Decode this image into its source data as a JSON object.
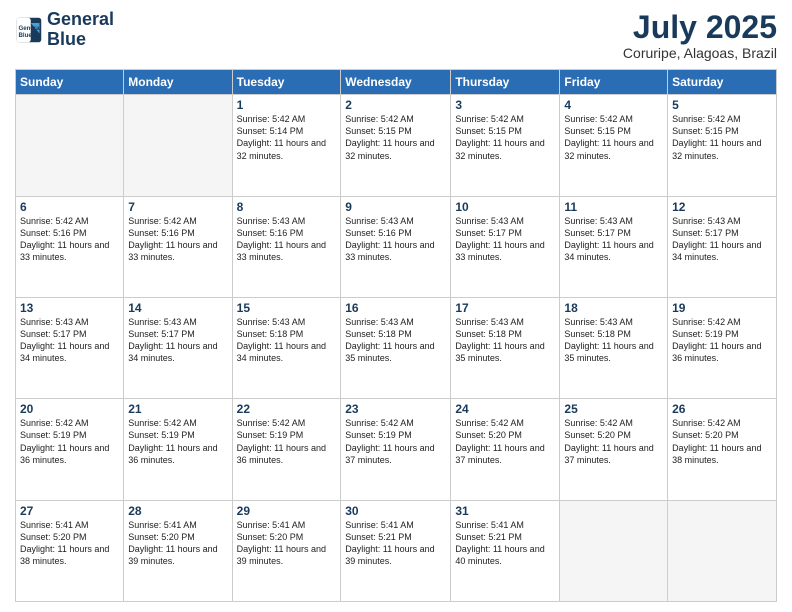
{
  "header": {
    "logo_line1": "General",
    "logo_line2": "Blue",
    "main_title": "July 2025",
    "subtitle": "Coruripe, Alagoas, Brazil"
  },
  "weekdays": [
    "Sunday",
    "Monday",
    "Tuesday",
    "Wednesday",
    "Thursday",
    "Friday",
    "Saturday"
  ],
  "weeks": [
    [
      {
        "day": "",
        "info": ""
      },
      {
        "day": "",
        "info": ""
      },
      {
        "day": "1",
        "info": "Sunrise: 5:42 AM\nSunset: 5:14 PM\nDaylight: 11 hours and 32 minutes."
      },
      {
        "day": "2",
        "info": "Sunrise: 5:42 AM\nSunset: 5:15 PM\nDaylight: 11 hours and 32 minutes."
      },
      {
        "day": "3",
        "info": "Sunrise: 5:42 AM\nSunset: 5:15 PM\nDaylight: 11 hours and 32 minutes."
      },
      {
        "day": "4",
        "info": "Sunrise: 5:42 AM\nSunset: 5:15 PM\nDaylight: 11 hours and 32 minutes."
      },
      {
        "day": "5",
        "info": "Sunrise: 5:42 AM\nSunset: 5:15 PM\nDaylight: 11 hours and 32 minutes."
      }
    ],
    [
      {
        "day": "6",
        "info": "Sunrise: 5:42 AM\nSunset: 5:16 PM\nDaylight: 11 hours and 33 minutes."
      },
      {
        "day": "7",
        "info": "Sunrise: 5:42 AM\nSunset: 5:16 PM\nDaylight: 11 hours and 33 minutes."
      },
      {
        "day": "8",
        "info": "Sunrise: 5:43 AM\nSunset: 5:16 PM\nDaylight: 11 hours and 33 minutes."
      },
      {
        "day": "9",
        "info": "Sunrise: 5:43 AM\nSunset: 5:16 PM\nDaylight: 11 hours and 33 minutes."
      },
      {
        "day": "10",
        "info": "Sunrise: 5:43 AM\nSunset: 5:17 PM\nDaylight: 11 hours and 33 minutes."
      },
      {
        "day": "11",
        "info": "Sunrise: 5:43 AM\nSunset: 5:17 PM\nDaylight: 11 hours and 34 minutes."
      },
      {
        "day": "12",
        "info": "Sunrise: 5:43 AM\nSunset: 5:17 PM\nDaylight: 11 hours and 34 minutes."
      }
    ],
    [
      {
        "day": "13",
        "info": "Sunrise: 5:43 AM\nSunset: 5:17 PM\nDaylight: 11 hours and 34 minutes."
      },
      {
        "day": "14",
        "info": "Sunrise: 5:43 AM\nSunset: 5:17 PM\nDaylight: 11 hours and 34 minutes."
      },
      {
        "day": "15",
        "info": "Sunrise: 5:43 AM\nSunset: 5:18 PM\nDaylight: 11 hours and 34 minutes."
      },
      {
        "day": "16",
        "info": "Sunrise: 5:43 AM\nSunset: 5:18 PM\nDaylight: 11 hours and 35 minutes."
      },
      {
        "day": "17",
        "info": "Sunrise: 5:43 AM\nSunset: 5:18 PM\nDaylight: 11 hours and 35 minutes."
      },
      {
        "day": "18",
        "info": "Sunrise: 5:43 AM\nSunset: 5:18 PM\nDaylight: 11 hours and 35 minutes."
      },
      {
        "day": "19",
        "info": "Sunrise: 5:42 AM\nSunset: 5:19 PM\nDaylight: 11 hours and 36 minutes."
      }
    ],
    [
      {
        "day": "20",
        "info": "Sunrise: 5:42 AM\nSunset: 5:19 PM\nDaylight: 11 hours and 36 minutes."
      },
      {
        "day": "21",
        "info": "Sunrise: 5:42 AM\nSunset: 5:19 PM\nDaylight: 11 hours and 36 minutes."
      },
      {
        "day": "22",
        "info": "Sunrise: 5:42 AM\nSunset: 5:19 PM\nDaylight: 11 hours and 36 minutes."
      },
      {
        "day": "23",
        "info": "Sunrise: 5:42 AM\nSunset: 5:19 PM\nDaylight: 11 hours and 37 minutes."
      },
      {
        "day": "24",
        "info": "Sunrise: 5:42 AM\nSunset: 5:20 PM\nDaylight: 11 hours and 37 minutes."
      },
      {
        "day": "25",
        "info": "Sunrise: 5:42 AM\nSunset: 5:20 PM\nDaylight: 11 hours and 37 minutes."
      },
      {
        "day": "26",
        "info": "Sunrise: 5:42 AM\nSunset: 5:20 PM\nDaylight: 11 hours and 38 minutes."
      }
    ],
    [
      {
        "day": "27",
        "info": "Sunrise: 5:41 AM\nSunset: 5:20 PM\nDaylight: 11 hours and 38 minutes."
      },
      {
        "day": "28",
        "info": "Sunrise: 5:41 AM\nSunset: 5:20 PM\nDaylight: 11 hours and 39 minutes."
      },
      {
        "day": "29",
        "info": "Sunrise: 5:41 AM\nSunset: 5:20 PM\nDaylight: 11 hours and 39 minutes."
      },
      {
        "day": "30",
        "info": "Sunrise: 5:41 AM\nSunset: 5:21 PM\nDaylight: 11 hours and 39 minutes."
      },
      {
        "day": "31",
        "info": "Sunrise: 5:41 AM\nSunset: 5:21 PM\nDaylight: 11 hours and 40 minutes."
      },
      {
        "day": "",
        "info": ""
      },
      {
        "day": "",
        "info": ""
      }
    ]
  ]
}
